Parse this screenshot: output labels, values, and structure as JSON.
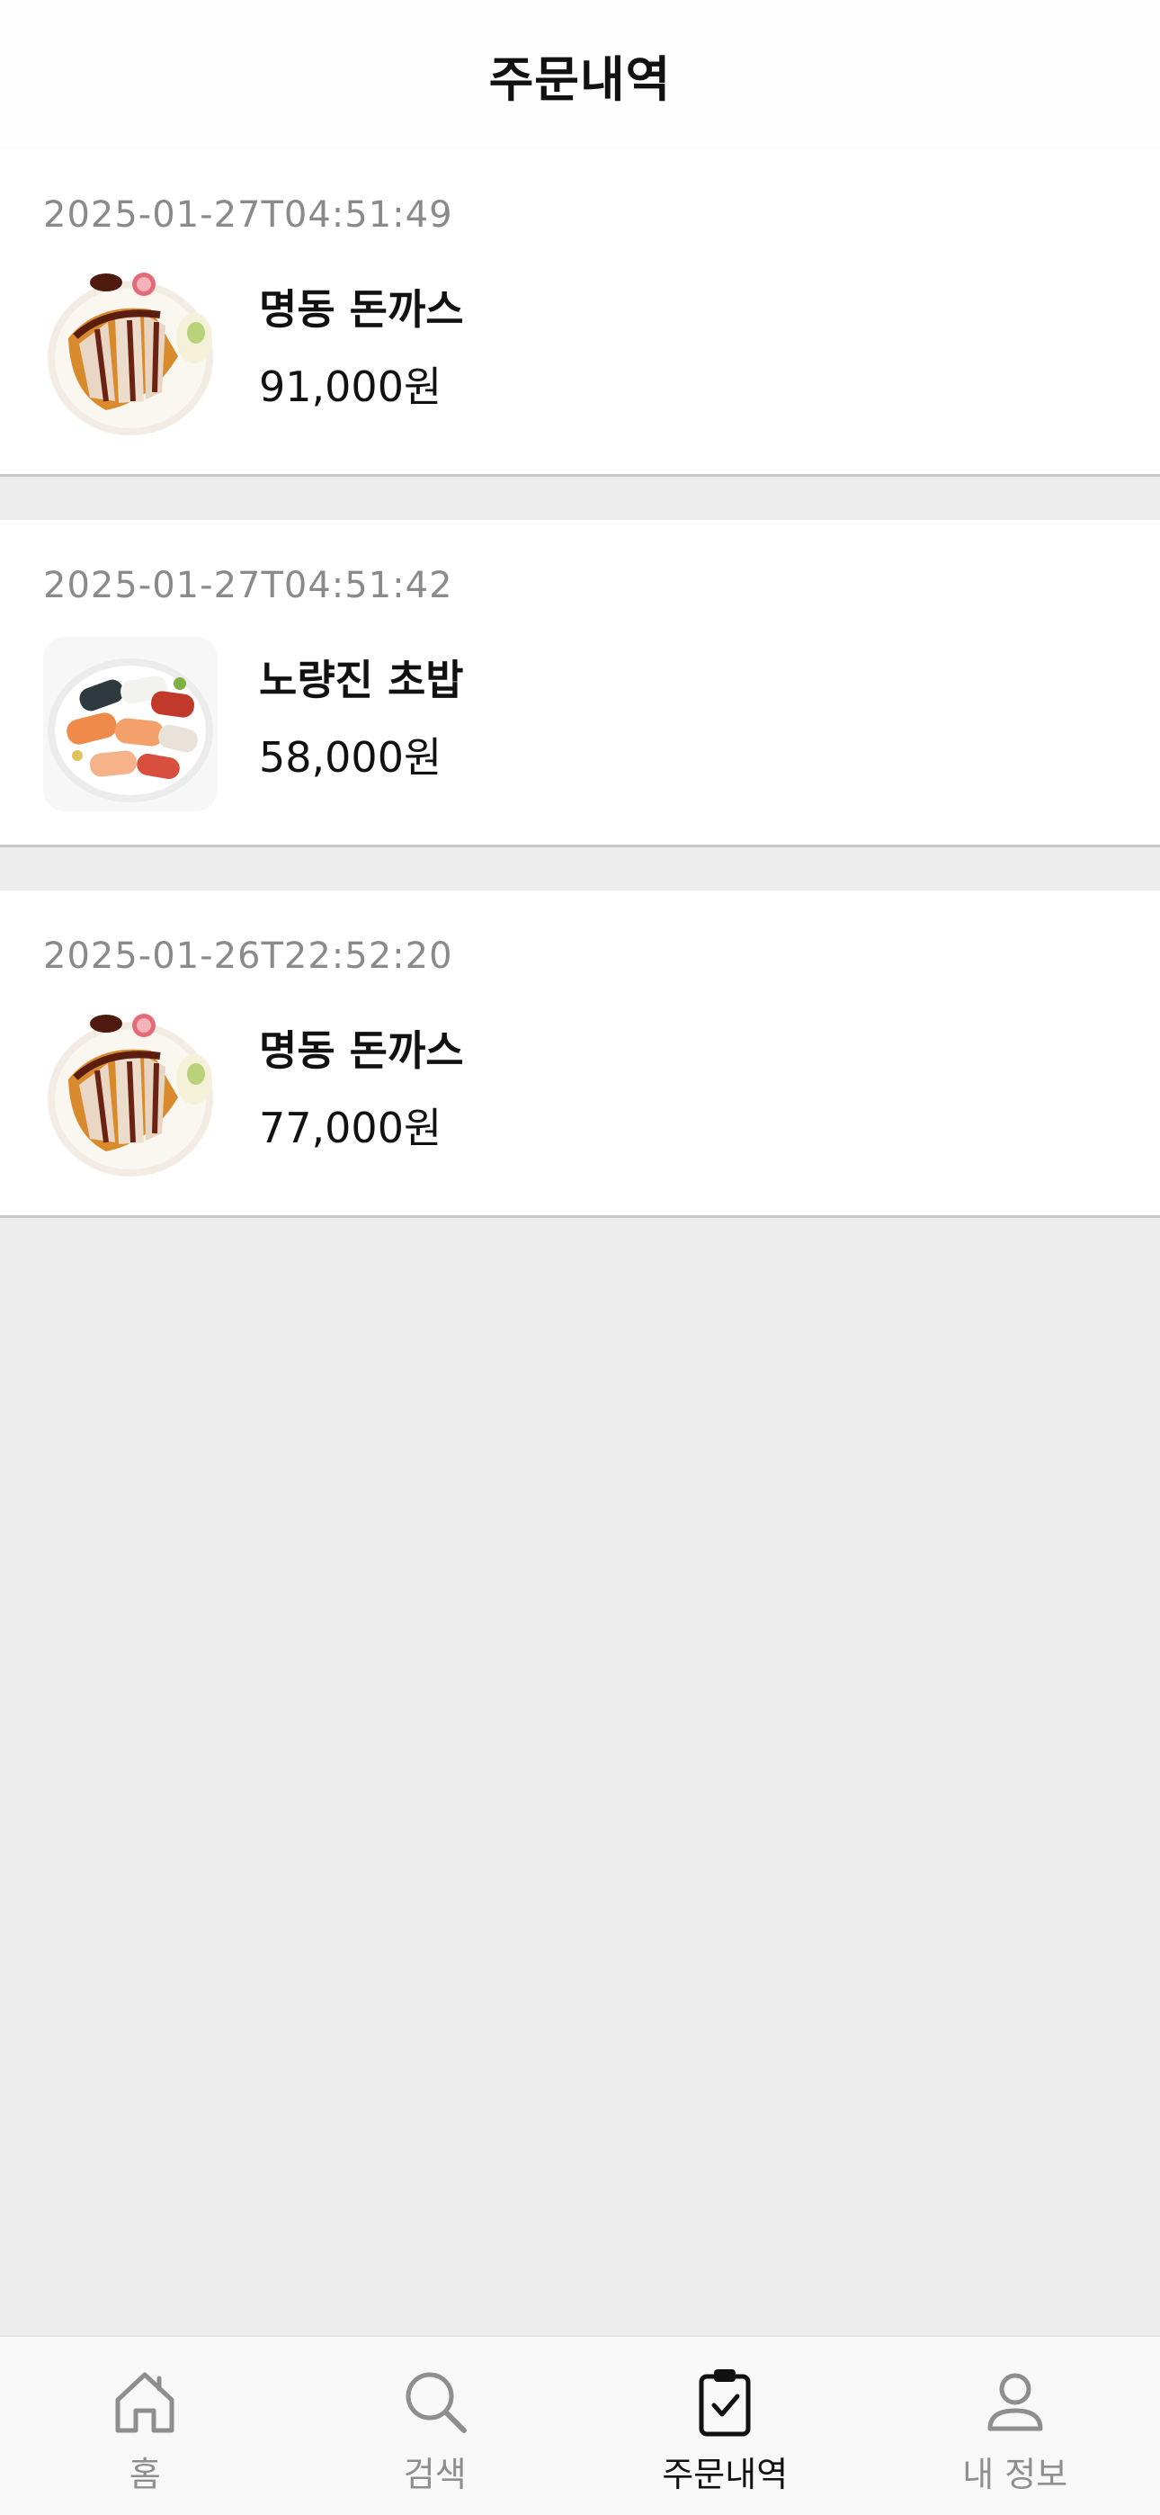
{
  "header": {
    "title": "주문내역"
  },
  "orders": [
    {
      "date": "2025-01-27T04:51:49",
      "name": "명동 돈까스",
      "price": "91,000원",
      "image": "tonkatsu"
    },
    {
      "date": "2025-01-27T04:51:42",
      "name": "노량진 초밥",
      "price": "58,000원",
      "image": "sushi"
    },
    {
      "date": "2025-01-26T22:52:20",
      "name": "명동 돈까스",
      "price": "77,000원",
      "image": "tonkatsu"
    }
  ],
  "tabbar": {
    "tabs": [
      {
        "label": "홈",
        "icon": "home-icon",
        "active": false
      },
      {
        "label": "검색",
        "icon": "search-icon",
        "active": false
      },
      {
        "label": "주문내역",
        "icon": "clipboard-check-icon",
        "active": true
      },
      {
        "label": "내 정보",
        "icon": "person-icon",
        "active": false
      }
    ]
  },
  "colors": {
    "background": "#ededed",
    "card": "#ffffff",
    "date_text": "#8a8a8a",
    "active_tab": "#111111",
    "inactive_tab": "#8e8e8e"
  }
}
